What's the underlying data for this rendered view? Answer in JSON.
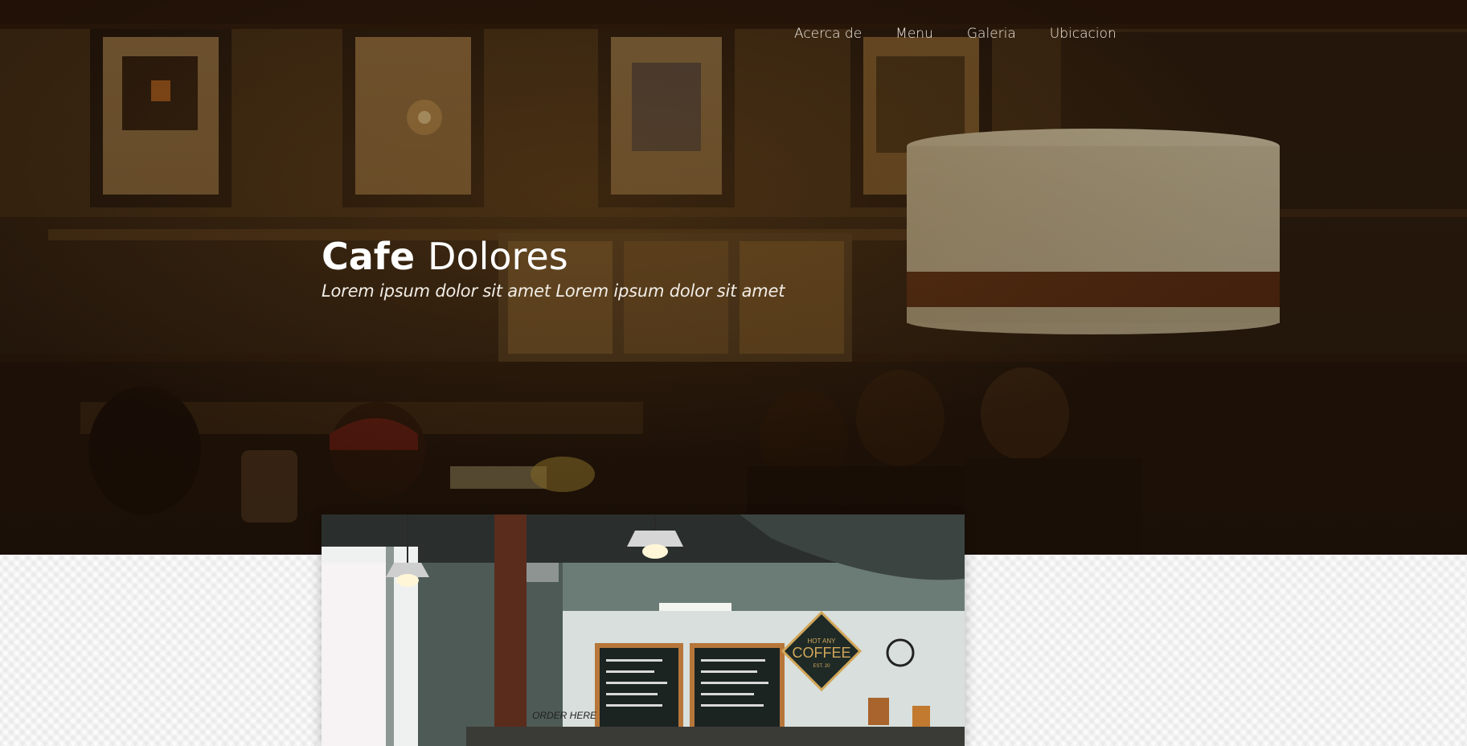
{
  "nav": {
    "items": [
      {
        "label": "Acerca de"
      },
      {
        "label": "Menu"
      },
      {
        "label": "Galeria"
      },
      {
        "label": "Ubicacion"
      }
    ]
  },
  "hero": {
    "title_bold": "Cafe",
    "title_light": "Dolores",
    "subtitle": "Lorem ipsum dolor sit amet Lorem ipsum dolor sit amet"
  },
  "feature": {
    "sign_text": "COFFEE",
    "sign_small_top": "HOT ANY",
    "sign_small_bottom": "EST. 20",
    "order_sign": "ORDER HERE"
  },
  "colors": {
    "hero_dark": "#2a1a0d",
    "nav_text": "#f3ece4",
    "pattern_bg": "#fbfbfb"
  }
}
